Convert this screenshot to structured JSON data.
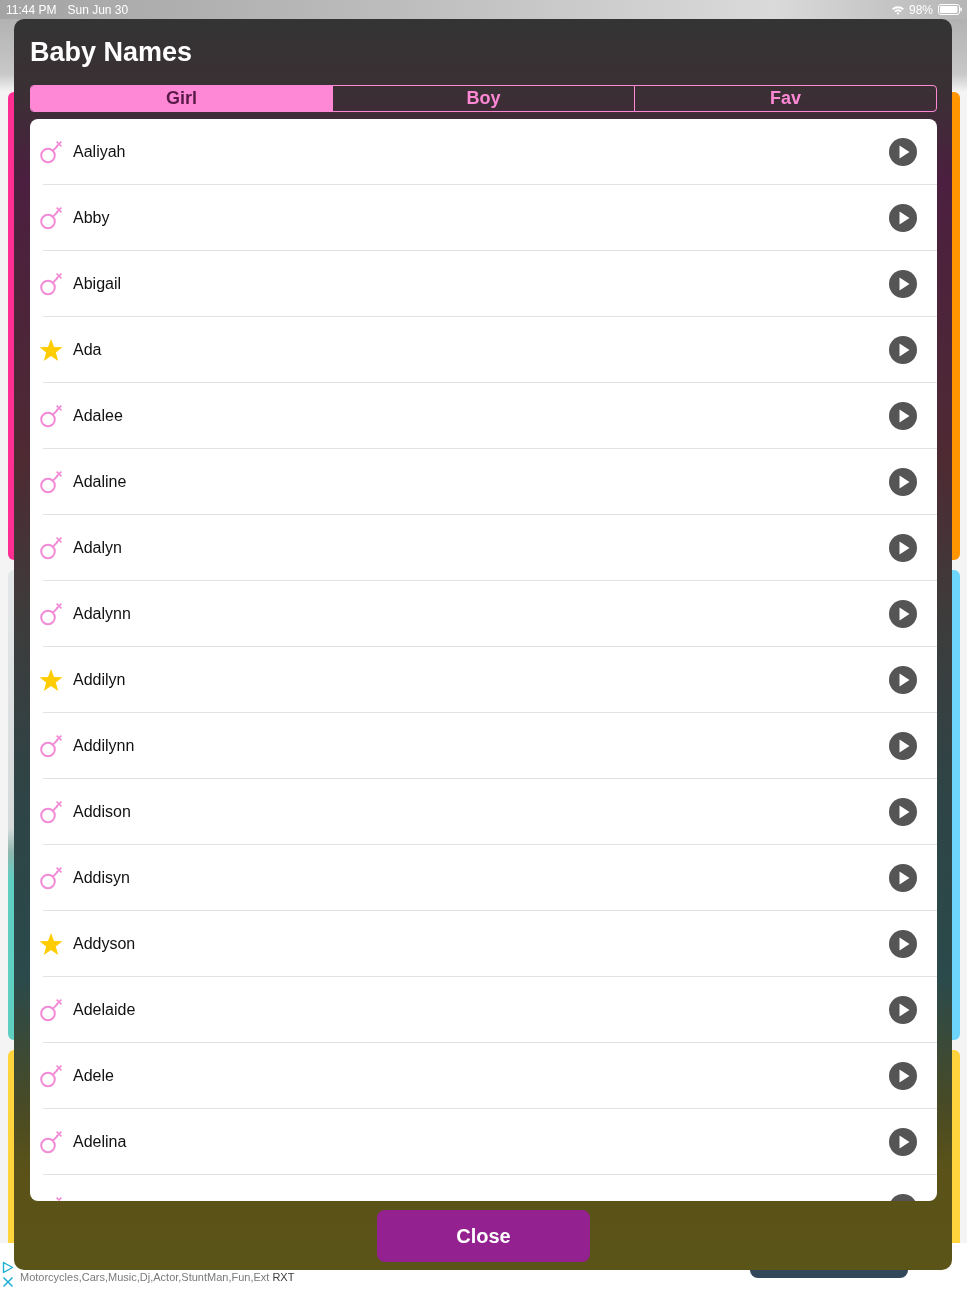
{
  "status_bar": {
    "time": "11:44 PM",
    "date": "Sun Jun 30",
    "battery": "98%"
  },
  "modal": {
    "title": "Baby Names",
    "tabs": [
      {
        "label": "Girl",
        "selected": true
      },
      {
        "label": "Boy",
        "selected": false
      },
      {
        "label": "Fav",
        "selected": false
      }
    ],
    "names": [
      {
        "name": "Aaliyah",
        "favorite": false
      },
      {
        "name": "Abby",
        "favorite": false
      },
      {
        "name": "Abigail",
        "favorite": false
      },
      {
        "name": "Ada",
        "favorite": true
      },
      {
        "name": "Adalee",
        "favorite": false
      },
      {
        "name": "Adaline",
        "favorite": false
      },
      {
        "name": "Adalyn",
        "favorite": false
      },
      {
        "name": "Adalynn",
        "favorite": false
      },
      {
        "name": "Addilyn",
        "favorite": true
      },
      {
        "name": "Addilynn",
        "favorite": false
      },
      {
        "name": "Addison",
        "favorite": false
      },
      {
        "name": "Addisyn",
        "favorite": false
      },
      {
        "name": "Addyson",
        "favorite": true
      },
      {
        "name": "Adelaide",
        "favorite": false
      },
      {
        "name": "Adele",
        "favorite": false
      },
      {
        "name": "Adelina",
        "favorite": false
      },
      {
        "favorite": false
      }
    ],
    "close_button": "Close"
  },
  "ad": {
    "text": "Motorcycles,Cars,Music,Dj,Actor,StuntMan,Fun,Ext",
    "advertiser": "RXT"
  }
}
